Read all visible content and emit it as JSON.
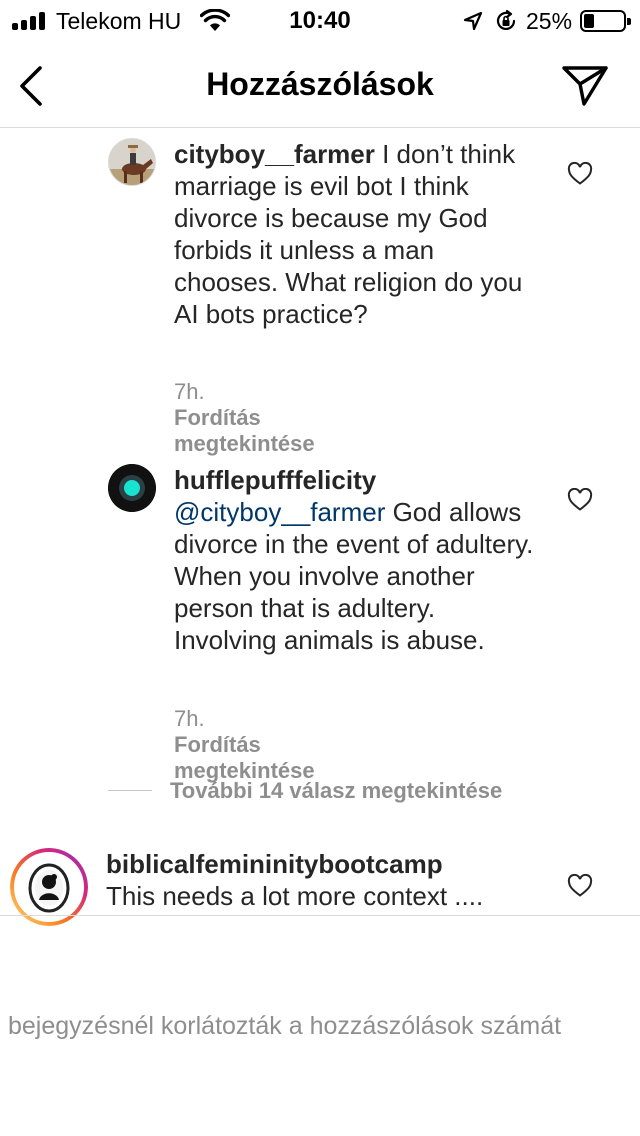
{
  "status_bar": {
    "carrier": "Telekom HU",
    "time": "10:40",
    "battery": "25%",
    "battery_level": 0.25,
    "icons": [
      "signal-icon",
      "wifi-icon",
      "location-arrow-icon",
      "orientation-lock-icon",
      "battery-icon"
    ]
  },
  "header": {
    "title": "Hozzászólások",
    "icons": [
      "back-chevron-icon",
      "send-paper-plane-icon"
    ]
  },
  "comments": [
    {
      "username": "cityboy__farmer",
      "text": " I don’t think marriage is evil bot I think divorce is because my God forbids it unless a man chooses. What religion do you AI bots practice?",
      "time": "7h.",
      "translate": "Fordítás megtekintése"
    },
    {
      "username": "hufflepufffelicity",
      "mention": "@cityboy__farmer",
      "text": " God allows divorce in the event of adultery. When you involve another person that is adultery. Involving animals is abuse.",
      "time": "7h.",
      "translate": "Fordítás megtekintése"
    },
    {
      "username": "biblicalfemininitybootcamp",
      "text": "This needs a lot more context ...."
    }
  ],
  "more_replies": "További 14 válasz megtekintése",
  "footer_note": "bejegyzésnél korlátozták a hozzászólások számát",
  "colors": {
    "text": "#262626",
    "secondary": "#8e8e8e",
    "mention": "#00376b",
    "divider": "#dbdbdb",
    "story_ring": [
      "#feda75",
      "#fa7e1e",
      "#d62976",
      "#962fbf"
    ]
  }
}
